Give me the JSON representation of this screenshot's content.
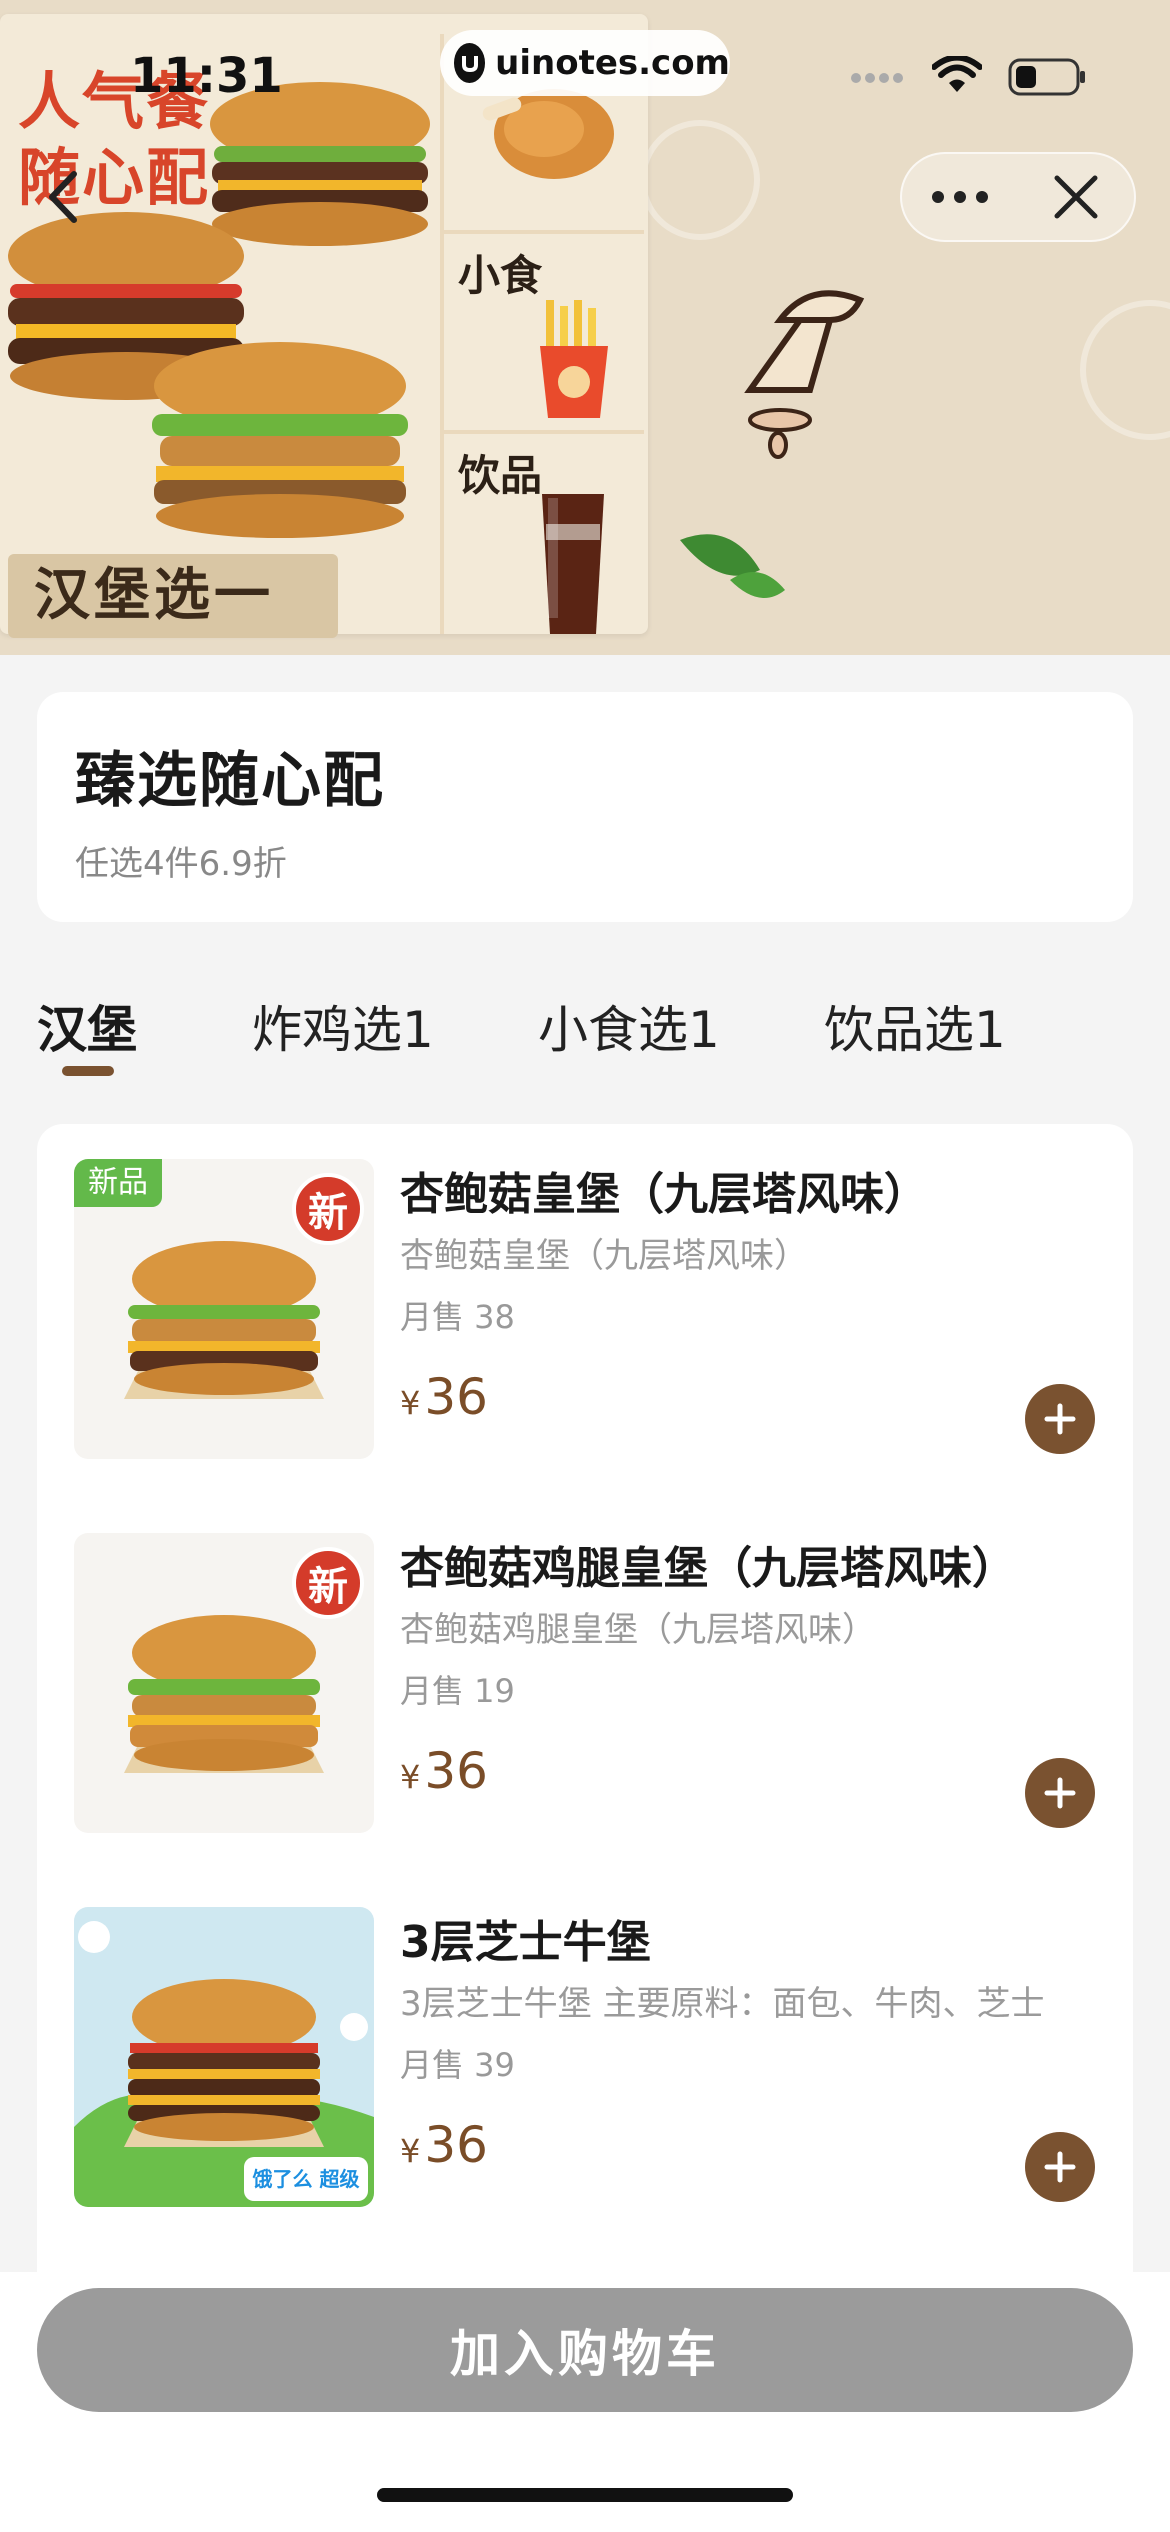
{
  "status_bar": {
    "time": "11:31",
    "url": "uinotes.com"
  },
  "banner": {
    "headline_line1": "人气餐",
    "headline_line2": "随心配",
    "choose_one": "汉堡选一",
    "cells": [
      "",
      "小食",
      "饮品"
    ],
    "colors": {
      "background": "#e8dcc7",
      "headline": "#d8452a"
    }
  },
  "info": {
    "title": "臻选随心配",
    "subtitle": "任选4件6.9折"
  },
  "tabs": [
    {
      "label": "汉堡",
      "active": true
    },
    {
      "label": "炸鸡选1",
      "active": false
    },
    {
      "label": "小食选1",
      "active": false
    },
    {
      "label": "饮品选1",
      "active": false
    }
  ],
  "products": [
    {
      "name": "杏鲍菇皇堡（九层塔风味）",
      "desc": "杏鲍菇皇堡（九层塔风味）",
      "sales": "月售 38",
      "currency": "¥",
      "price": "36",
      "tag": "新品",
      "badge": "新"
    },
    {
      "name": "杏鲍菇鸡腿皇堡（九层塔风味）",
      "desc": "杏鲍菇鸡腿皇堡（九层塔风味）",
      "sales": "月售 19",
      "currency": "¥",
      "price": "36",
      "badge": "新"
    },
    {
      "name": "3层芝士牛堡",
      "desc": "3层芝士牛堡 主要原料：面包、牛肉、芝士",
      "sales": "月售 39",
      "currency": "¥",
      "price": "36",
      "sticker": "饿了么 超级限定"
    }
  ],
  "cart_button": "加入购物车",
  "colors": {
    "accent": "#7a5230",
    "price": "#7a4d28",
    "cart_disabled": "#9b9b9b"
  }
}
